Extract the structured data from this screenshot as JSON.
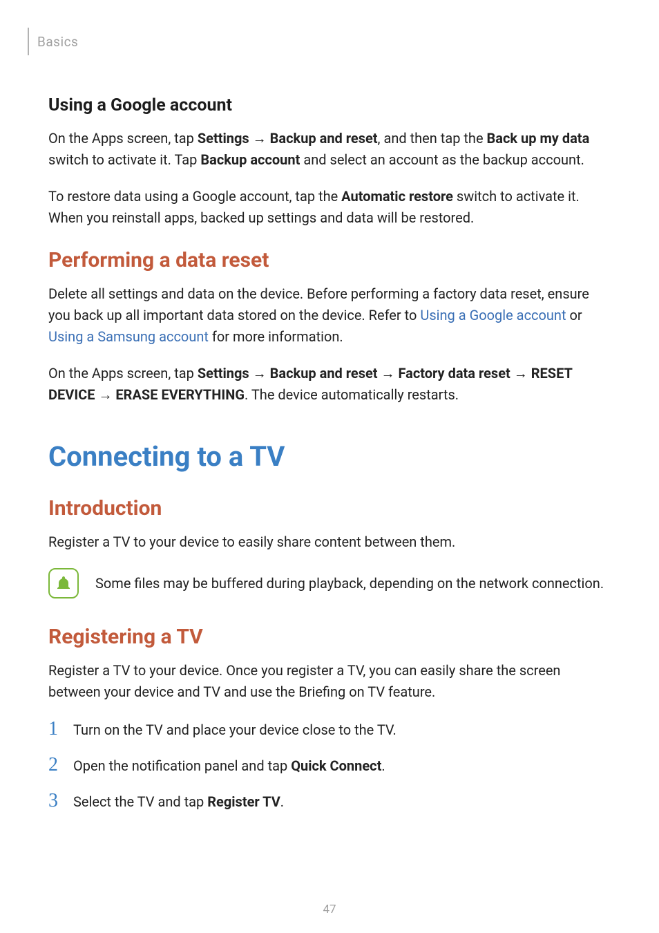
{
  "chapter": "Basics",
  "section_google": {
    "heading": "Using a Google account",
    "p1_t1": "On the Apps screen, tap ",
    "p1_b1": "Settings",
    "p1_t2": " → ",
    "p1_b2": "Backup and reset",
    "p1_t3": ", and then tap the ",
    "p1_b3": "Back up my data",
    "p1_t4": " switch to activate it. Tap ",
    "p1_b4": "Backup account",
    "p1_t5": " and select an account as the backup account.",
    "p2_t1": "To restore data using a Google account, tap the ",
    "p2_b1": "Automatic restore",
    "p2_t2": " switch to activate it. When you reinstall apps, backed up settings and data will be restored."
  },
  "section_reset": {
    "heading": "Performing a data reset",
    "p1_t1": "Delete all settings and data on the device. Before performing a factory data reset, ensure you back up all important data stored on the device. Refer to ",
    "p1_link1": "Using a Google account",
    "p1_t2": " or ",
    "p1_link2": "Using a Samsung account",
    "p1_t3": " for more information.",
    "p2_t1": "On the Apps screen, tap ",
    "p2_b1": "Settings",
    "p2_t2": " → ",
    "p2_b2": "Backup and reset",
    "p2_t3": " → ",
    "p2_b3": "Factory data reset",
    "p2_t4": " → ",
    "p2_b4": "RESET DEVICE",
    "p2_t5": " → ",
    "p2_b5": "ERASE EVERYTHING",
    "p2_t6": ". The device automatically restarts."
  },
  "section_tv": {
    "heading": "Connecting to a TV",
    "intro_heading": "Introduction",
    "intro_p1": "Register a TV to your device to easily share content between them.",
    "note": "Some files may be buffered during playback, depending on the network connection.",
    "reg_heading": "Registering a TV",
    "reg_p1": "Register a TV to your device. Once you register a TV, you can easily share the screen between your device and TV and use the Briefing on TV feature.",
    "steps": [
      {
        "num": "1",
        "text_1": "Turn on the TV and place your device close to the TV."
      },
      {
        "num": "2",
        "text_1": "Open the notification panel and tap ",
        "bold": "Quick Connect",
        "text_2": "."
      },
      {
        "num": "3",
        "text_1": "Select the TV and tap ",
        "bold": "Register TV",
        "text_2": "."
      }
    ]
  },
  "page_number": "47"
}
